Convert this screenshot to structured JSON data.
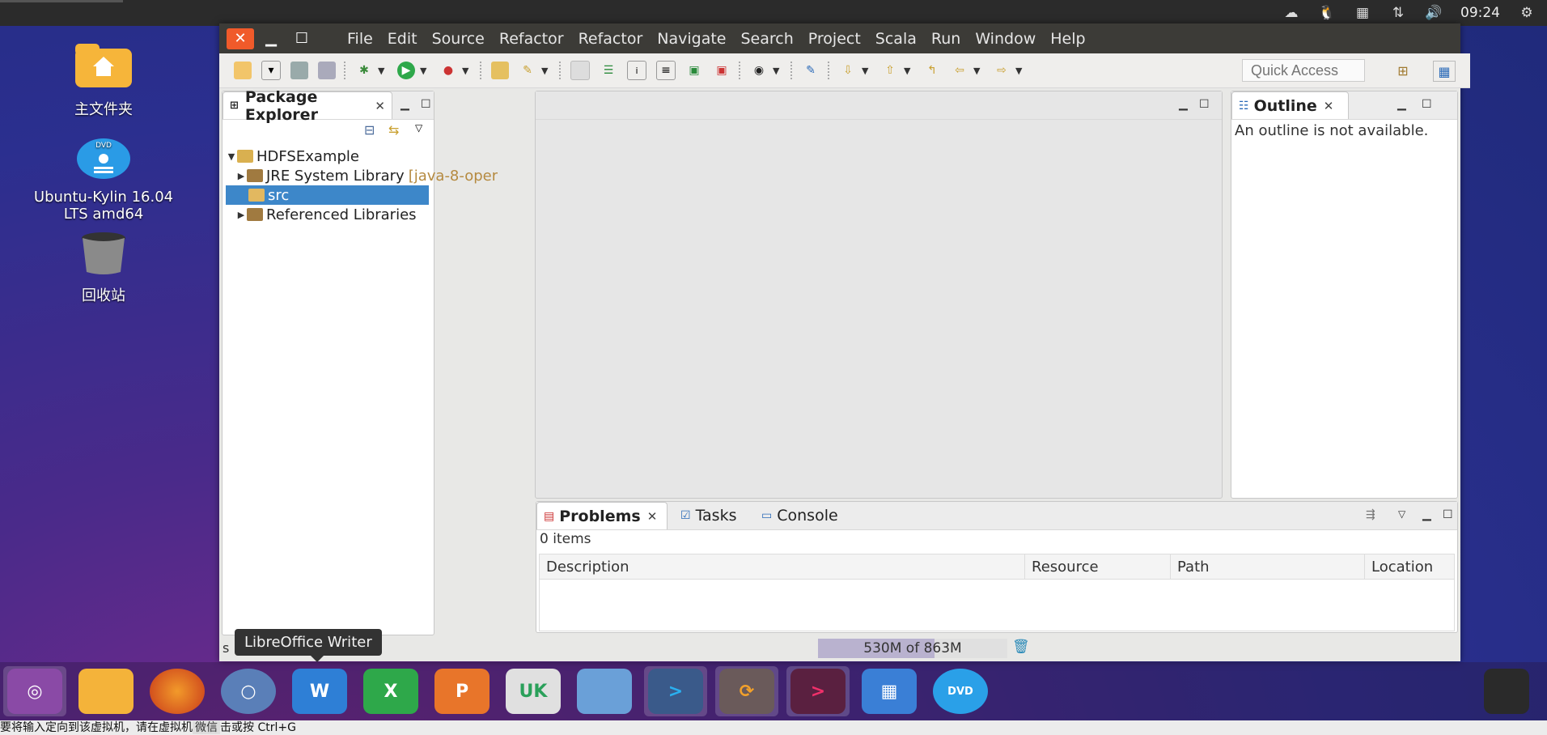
{
  "top_panel": {
    "clock": "09:24",
    "tray_icons": [
      "weather-icon",
      "qq-penguin-icon",
      "calendar-icon",
      "network-arrows-icon",
      "volume-icon",
      "settings-gear-icon"
    ]
  },
  "desktop": {
    "icons": [
      {
        "label": "主文件夹",
        "icon": "home-folder-icon"
      },
      {
        "label": "Ubuntu-Kylin 16.04 LTS amd64",
        "icon": "dvd-icon"
      },
      {
        "label": "回收站",
        "icon": "trash-icon"
      }
    ]
  },
  "eclipse": {
    "menus": [
      "File",
      "Edit",
      "Source",
      "Refactor",
      "Refactor",
      "Navigate",
      "Search",
      "Project",
      "Scala",
      "Run",
      "Window",
      "Help"
    ],
    "quick_access_placeholder": "Quick Access",
    "package_explorer": {
      "title": "Package Explorer",
      "tree": [
        {
          "label": "HDFSExample",
          "suffix": "",
          "expanded": true,
          "selected": false
        },
        {
          "label": "JRE System Library",
          "suffix": "[java-8-oper",
          "expanded": false,
          "selected": false
        },
        {
          "label": "src",
          "suffix": "",
          "expanded": false,
          "selected": true
        },
        {
          "label": "Referenced Libraries",
          "suffix": "",
          "expanded": false,
          "selected": false
        }
      ]
    },
    "outline": {
      "title": "Outline",
      "message": "An outline is not available."
    },
    "bottom": {
      "tabs": [
        "Problems",
        "Tasks",
        "Console"
      ],
      "count": "0 items",
      "columns": [
        "Description",
        "Resource",
        "Path",
        "Location"
      ]
    },
    "status": {
      "left": "s",
      "heap": "530M of 863M",
      "heap_used_fraction": 0.614
    }
  },
  "tooltip": "LibreOffice Writer",
  "dock": {
    "items": [
      {
        "name": "ubuntu-kylin-start",
        "glyph": "◎",
        "color": "#8a4aa6"
      },
      {
        "name": "files",
        "glyph": "",
        "color": "#f4b33a"
      },
      {
        "name": "firefox",
        "glyph": "",
        "color": "#e8632a"
      },
      {
        "name": "chromium",
        "glyph": "○",
        "color": "#5a7fb8"
      },
      {
        "name": "libreoffice-writer",
        "glyph": "W",
        "color": "#2e7fd6"
      },
      {
        "name": "libreoffice-calc",
        "glyph": "X",
        "color": "#2ea84a"
      },
      {
        "name": "libreoffice-impress",
        "glyph": "P",
        "color": "#e8752a"
      },
      {
        "name": "ubuntu-kylin-software",
        "glyph": "UK",
        "color": "#3a86c8"
      },
      {
        "name": "disk-usage",
        "glyph": "",
        "color": "#6aa0d8"
      },
      {
        "name": "eclipse-scala-1",
        "glyph": ">",
        "color": "#3a5a8a"
      },
      {
        "name": "sync",
        "glyph": "⟳",
        "color": "#6a5a5a"
      },
      {
        "name": "eclipse-scala-2",
        "glyph": ">",
        "color": "#5a2040"
      },
      {
        "name": "workspace-switcher",
        "glyph": "",
        "color": "#3a7fd6"
      },
      {
        "name": "dvd",
        "glyph": "DVD",
        "color": "#2aa0e8"
      }
    ]
  },
  "bottom_message": {
    "part1": "要将输入定向到该虚拟机，请在虚拟机",
    "part2": "微信",
    "part3": "击或按 Ctrl+G"
  }
}
